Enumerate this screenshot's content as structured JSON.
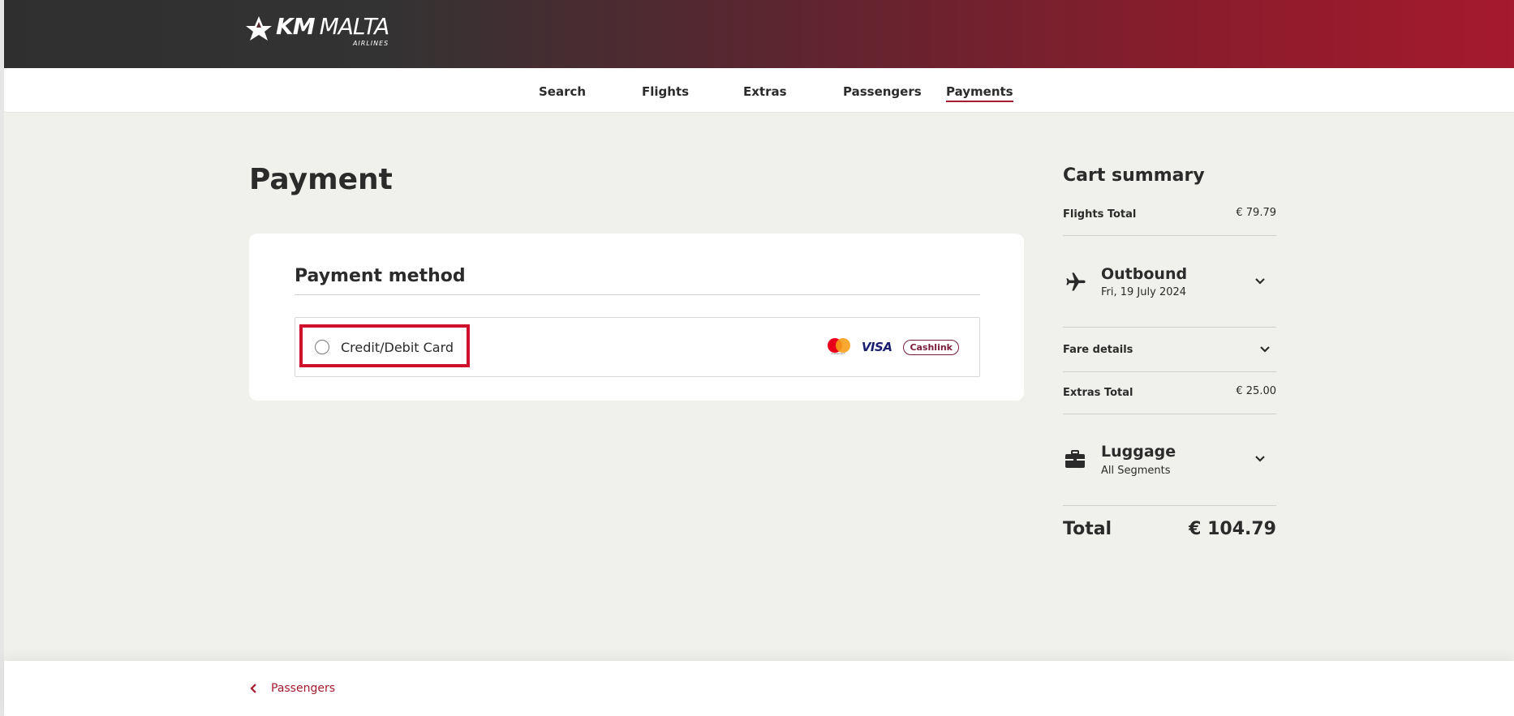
{
  "brand": {
    "logo_main_bold": "KM",
    "logo_main": "MALTA",
    "logo_sub": "AIRLINES",
    "primary_color": "#a51a2d",
    "header_dark": "#2f2f2f"
  },
  "nav": {
    "items": [
      {
        "label": "Search"
      },
      {
        "label": "Flights"
      },
      {
        "label": "Extras"
      },
      {
        "label": "Passengers"
      },
      {
        "label": "Payments",
        "active": true
      }
    ]
  },
  "page": {
    "title": "Payment"
  },
  "payment": {
    "section_title": "Payment method",
    "option_label": "Credit/Debit Card",
    "option_selected": false,
    "card_brands": [
      {
        "name": "mastercard-icon",
        "label": "mastercard"
      },
      {
        "name": "visa-icon",
        "label": "VISA"
      },
      {
        "name": "cashlink-icon",
        "label": "Cashlink"
      }
    ]
  },
  "cart": {
    "title": "Cart summary",
    "flights_total_label": "Flights Total",
    "flights_total_value": "€ 79.79",
    "outbound": {
      "title": "Outbound",
      "date": "Fri, 19 July 2024",
      "icon": "airplane-icon"
    },
    "fare_details_label": "Fare details",
    "extras_total_label": "Extras Total",
    "extras_total_value": "€ 25.00",
    "luggage": {
      "title": "Luggage",
      "subtitle": "All Segments",
      "icon": "suitcase-icon"
    },
    "total_label": "Total",
    "total_value": "€ 104.79"
  },
  "footer": {
    "back_label": "Passengers"
  }
}
